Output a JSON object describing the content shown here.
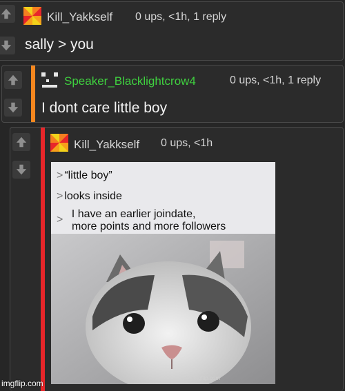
{
  "comments": [
    {
      "username": "Kill_Yakkself",
      "meta": "0 ups, <1h, 1 reply",
      "text": "sally > you",
      "name_color": "#d8d8d8",
      "bar_color": ""
    },
    {
      "username": "Speaker_Blacklightcrow4",
      "meta": "0 ups, <1h, 1 reply",
      "text": "I dont care little boy",
      "name_color": "#3fd03f",
      "bar_color": "#f5871f"
    },
    {
      "username": "Kill_Yakkself",
      "meta": "0 ups, <1h",
      "name_color": "#d8d8d8",
      "bar_color": "#e8262a",
      "meme": {
        "line1_prefix": ">",
        "line1": "“little boy”",
        "line2_prefix": ">",
        "line2": "looks inside",
        "line3_prefix": ">",
        "line3": "I have an earlier joindate,",
        "line4": "more points and more followers",
        "image_watermark": "imgflip.com"
      }
    }
  ],
  "watermark": "imgflip.com",
  "icons": {
    "upvote": "arrow-up-icon",
    "downvote": "arrow-down-icon",
    "avatar_yakk": "pinwheel-avatar-icon",
    "avatar_speaker": "pixel-face-avatar-icon"
  }
}
